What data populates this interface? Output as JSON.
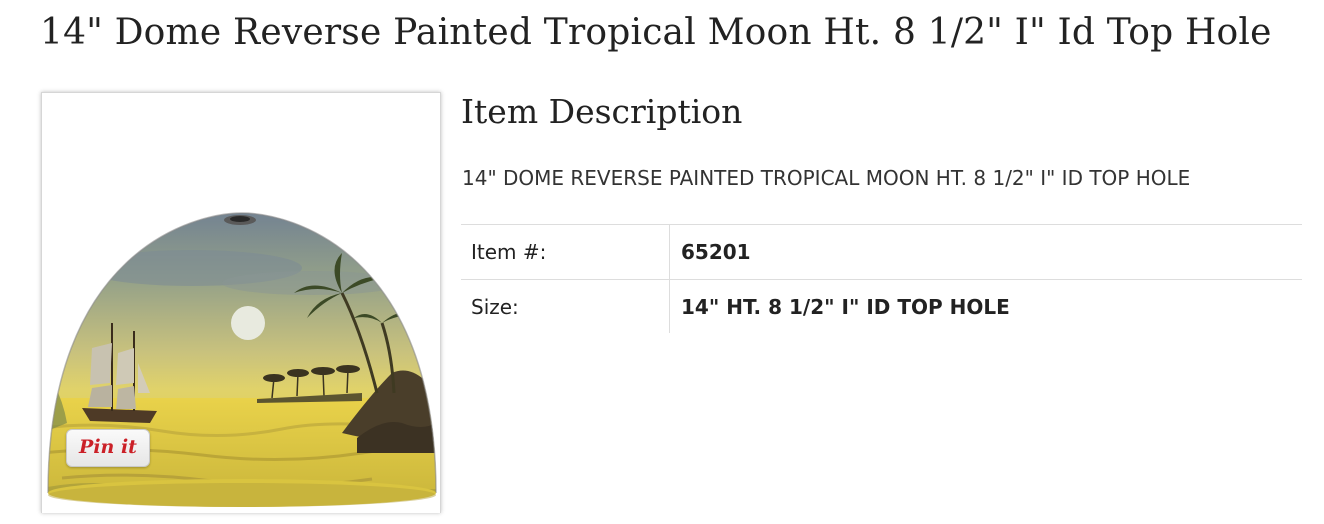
{
  "product": {
    "title": "14\" Dome Reverse Painted Tropical Moon Ht. 8 1/2\" I\" Id Top Hole"
  },
  "image": {
    "pin_label": "Pin it",
    "pin_color": "#cb2027"
  },
  "description": {
    "heading": "Item Description",
    "text": "14\" DOME REVERSE PAINTED TROPICAL MOON HT. 8 1/2\" I\" ID TOP HOLE"
  },
  "specs": [
    {
      "label": "Item #:",
      "value": "65201"
    },
    {
      "label": "Size:",
      "value": "14\" HT. 8 1/2\" I\" ID TOP HOLE"
    }
  ]
}
